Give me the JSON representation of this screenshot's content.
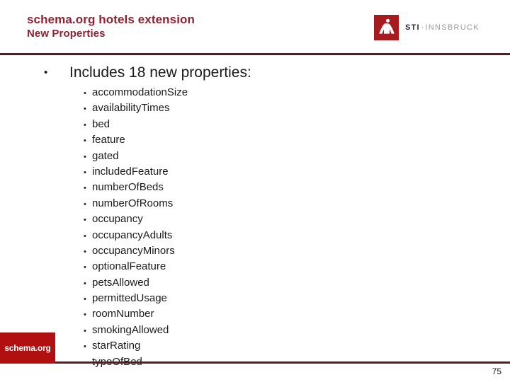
{
  "slide": {
    "title_line1": "schema.org hotels extension",
    "title_line2": "New Properties",
    "page_number": "75",
    "accent_color": "#8b2332",
    "rule_color": "#5d1a1d"
  },
  "logo": {
    "mark_color": "#a51b20",
    "name_bold": "STI",
    "separator": "·",
    "name_light": "INNSBRUCK",
    "icon": "sti-person-icon"
  },
  "content": {
    "level1_bullet": "•",
    "level1_text": "Includes 18 new properties:",
    "level2_bullet": "•",
    "properties": [
      "accommodationSize",
      "availabilityTimes",
      "bed",
      "feature",
      "gated",
      "includedFeature",
      "numberOfBeds",
      "numberOfRooms",
      "occupancy",
      "occupancyAdults",
      "occupancyMinors",
      "optionalFeature",
      "petsAllowed",
      "permittedUsage",
      "roomNumber",
      "smokingAllowed",
      "starRating",
      "typeOfBed"
    ]
  },
  "badge": {
    "label": "schema.org",
    "background_color": "#b01010"
  }
}
